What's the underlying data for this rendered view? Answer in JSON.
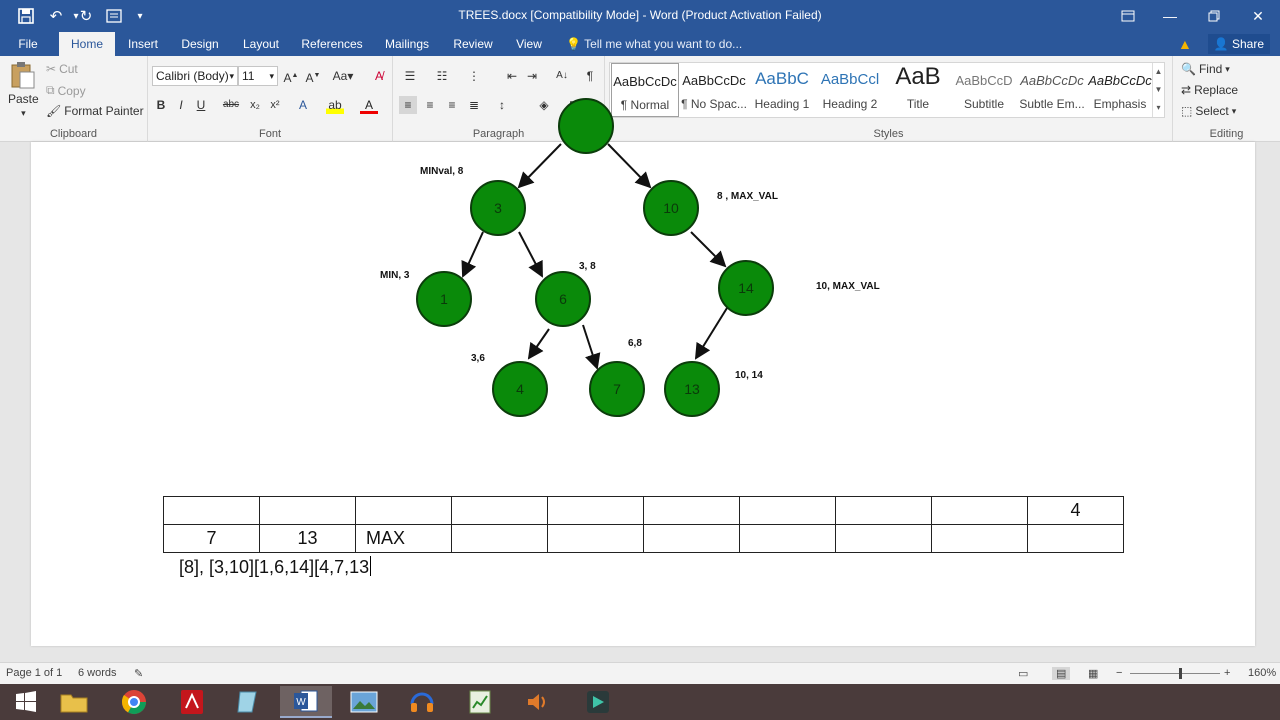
{
  "window": {
    "title": "TREES.docx [Compatibility Mode] - Word (Product Activation Failed)"
  },
  "tabs": [
    "File",
    "Home",
    "Insert",
    "Design",
    "Layout",
    "References",
    "Mailings",
    "Review",
    "View"
  ],
  "tell_me": "Tell me what you want to do...",
  "share_label": "Share",
  "clipboard": {
    "paste": "Paste",
    "cut": "Cut",
    "copy": "Copy",
    "format_painter": "Format Painter",
    "label": "Clipboard"
  },
  "font": {
    "name": "Calibri (Body)",
    "size": "11",
    "label": "Font"
  },
  "paragraph": {
    "label": "Paragraph"
  },
  "styles": {
    "label": "Styles",
    "items": [
      {
        "sample": "AaBbCcDc",
        "name": "¶ Normal"
      },
      {
        "sample": "AaBbCcDc",
        "name": "¶ No Spac..."
      },
      {
        "sample": "AaBbC",
        "name": "Heading 1"
      },
      {
        "sample": "AaBbCcl",
        "name": "Heading 2"
      },
      {
        "sample": "AaB",
        "name": "Title"
      },
      {
        "sample": "AaBbCcD",
        "name": "Subtitle"
      },
      {
        "sample": "AaBbCcDc",
        "name": "Subtle Em..."
      },
      {
        "sample": "AaBbCcDc",
        "name": "Emphasis"
      }
    ]
  },
  "editing": {
    "find": "Find",
    "replace": "Replace",
    "select": "Select",
    "label": "Editing"
  },
  "tree": {
    "nodes": [
      "3",
      "10",
      "1",
      "6",
      "14",
      "4",
      "7",
      "13"
    ],
    "annotations": [
      "MINval, 8",
      "8 , MAX_VAL",
      "MIN, 3",
      "3, 8",
      "10, MAX_VAL",
      "3,6",
      "6,8",
      "10, 14"
    ]
  },
  "table": {
    "row1": [
      "",
      "",
      "",
      "",
      "",
      "",
      "",
      "",
      "",
      "4"
    ],
    "row2": [
      "7",
      "13",
      "MAX",
      "",
      "",
      "",
      "",
      "",
      "",
      ""
    ]
  },
  "body_text": "[8], [3,10][1,6,14][4,7,13",
  "status": {
    "page": "Page 1 of 1",
    "words": "6 words",
    "zoom": "160%"
  },
  "colors": {
    "word_blue": "#2b579a",
    "node_green": "#0a8a0a"
  }
}
